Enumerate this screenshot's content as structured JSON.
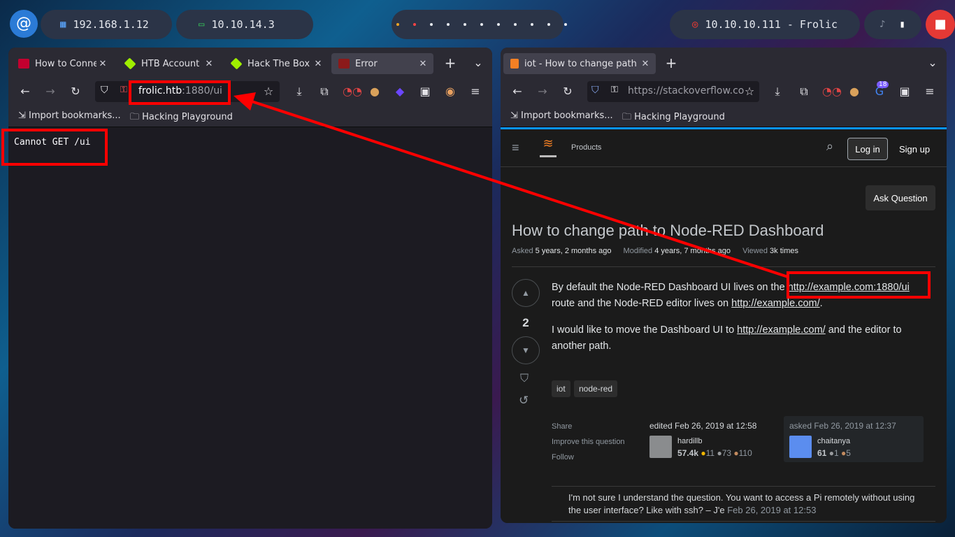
{
  "topbar": {
    "local_ip": "192.168.1.12",
    "vpn_ip": "10.10.14.3",
    "target": "10.10.10.111 - Frolic",
    "dot_colors": [
      "#f5a623",
      "#ff4444",
      "#e6e9ef",
      "#e6e9ef",
      "#e6e9ef",
      "#e6e9ef",
      "#e6e9ef",
      "#e6e9ef",
      "#e6e9ef",
      "#e6e9ef",
      "#e6e9ef"
    ]
  },
  "left_browser": {
    "tabs": [
      {
        "label": "How to Connec",
        "icon": "htb-red-icon"
      },
      {
        "label": "HTB Account",
        "icon": "htb-cube-icon"
      },
      {
        "label": "Hack The Box :",
        "icon": "htb-cube-icon"
      },
      {
        "label": "Error",
        "icon": "error-icon"
      }
    ],
    "url_host": "frolic.htb",
    "url_rest": ":1880/ui",
    "bookmarks": [
      "Import bookmarks...",
      "Hacking Playground"
    ],
    "body_text": "Cannot GET /ui"
  },
  "right_browser": {
    "tabs": [
      {
        "label": "iot - How to change path to",
        "icon": "stackoverflow-icon"
      }
    ],
    "url": "https://stackoverflow.co",
    "extension_badge": "18",
    "bookmarks": [
      "Import bookmarks...",
      "Hacking Playground"
    ],
    "page": {
      "nav_products": "Products",
      "login": "Log in",
      "signup": "Sign up",
      "ask": "Ask Question",
      "title": "How to change path to Node-RED Dashboard",
      "meta": {
        "asked_label": "Asked",
        "asked_value": "5 years, 2 months ago",
        "modified_label": "Modified",
        "modified_value": "4 years, 7 months ago",
        "viewed_label": "Viewed",
        "viewed_value": "3k times"
      },
      "votes": "2",
      "body_p1_a": "By default the Node-RED Dashboard UI lives on the ",
      "body_p1_link": "http://example.com:1880/ui",
      "body_p1_b": "route and the Node-RED editor lives on ",
      "body_p1_link2": "http://example.com/",
      "body_p1_c": ".",
      "body_p2_a": "I would like to move the Dashboard UI to ",
      "body_p2_link": "http://example.com/",
      "body_p2_b": " and the editor to",
      "body_p2_c": "another path.",
      "tags": [
        "iot",
        "node-red"
      ],
      "actions": [
        "Share",
        "Improve this question",
        "Follow"
      ],
      "edited": {
        "label": "edited Feb 26, 2019 at 12:58",
        "user": "hardillb",
        "rep": "57.4k",
        "gold": "11",
        "silver": "73",
        "bronze": "110"
      },
      "asked": {
        "label": "asked Feb 26, 2019 at 12:37",
        "user": "chaitanya",
        "rep": "61",
        "silver": "1",
        "bronze": "5"
      },
      "comment_a": "I'm not sure I understand the question. You want to access a Pi remotely without using",
      "comment_b": "the user interface? Like with ssh? – ",
      "comment_user": "J'e",
      "comment_date": " Feb 26, 2019 at 12:53"
    }
  },
  "annotation_color": "#ff0000"
}
